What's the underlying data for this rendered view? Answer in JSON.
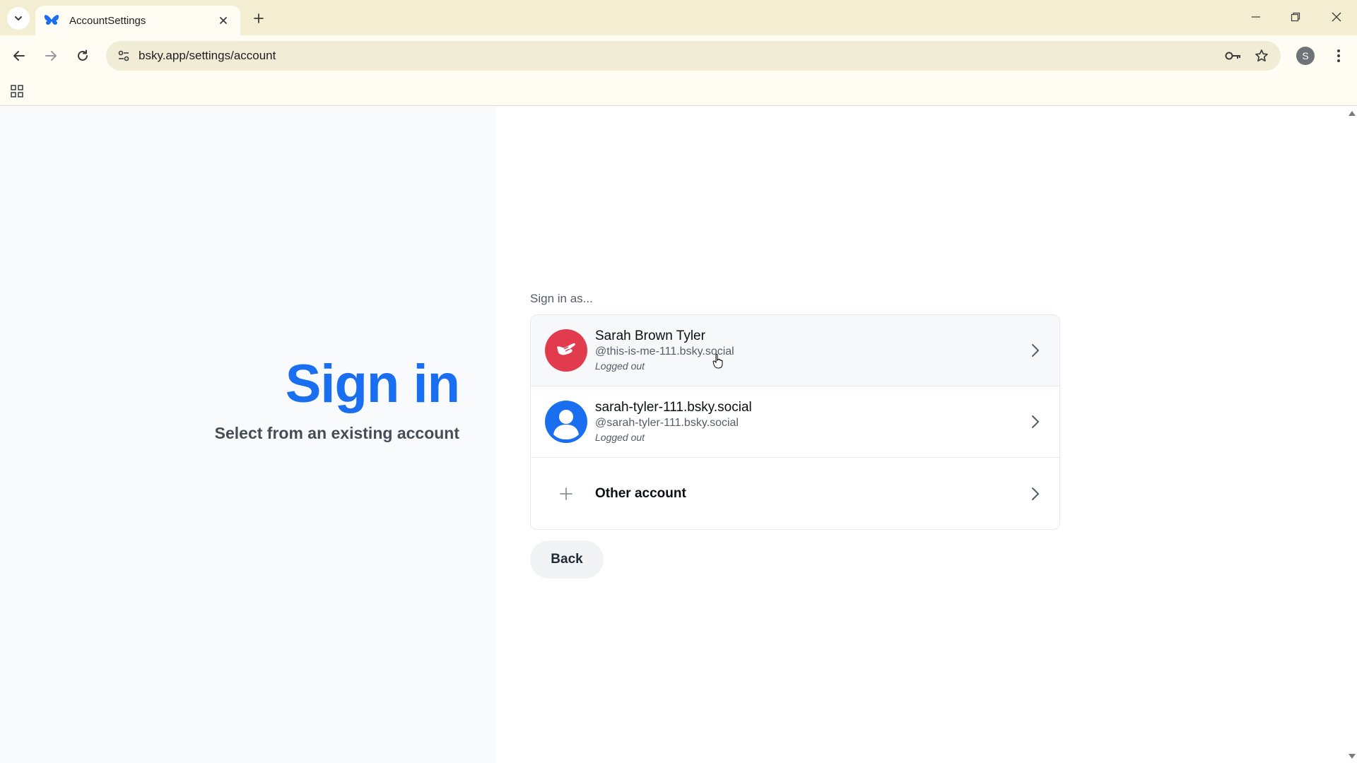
{
  "browser": {
    "tab_title": "AccountSettings",
    "url": "bsky.app/settings/account",
    "profile_initial": "S",
    "icons": {
      "tab_search": "chevron-down-icon",
      "favicon": "butterfly-icon",
      "tab_close": "close-icon",
      "new_tab": "plus-icon",
      "back": "arrow-left-icon",
      "forward": "arrow-right-icon",
      "reload": "reload-icon",
      "site_info": "tune-icon",
      "password": "key-icon",
      "bookmark": "star-icon",
      "menu": "kebab-menu-icon",
      "apps": "apps-grid-icon"
    }
  },
  "page": {
    "title": "Sign in",
    "subtitle": "Select from an existing account",
    "sign_in_as": "Sign in as...",
    "accounts": [
      {
        "name": "Sarah Brown Tyler",
        "handle": "@this-is-me-111.bsky.social",
        "status": "Logged out",
        "avatar_color": "#e23b4e"
      },
      {
        "name": "sarah-tyler-111.bsky.social",
        "handle": "@sarah-tyler-111.bsky.social",
        "status": "Logged out",
        "avatar_color": "#1a6ff0"
      }
    ],
    "other_account_label": "Other account",
    "back_label": "Back"
  },
  "colors": {
    "brand_blue": "#1a6ff0",
    "chrome_bg": "#f3eed1"
  }
}
